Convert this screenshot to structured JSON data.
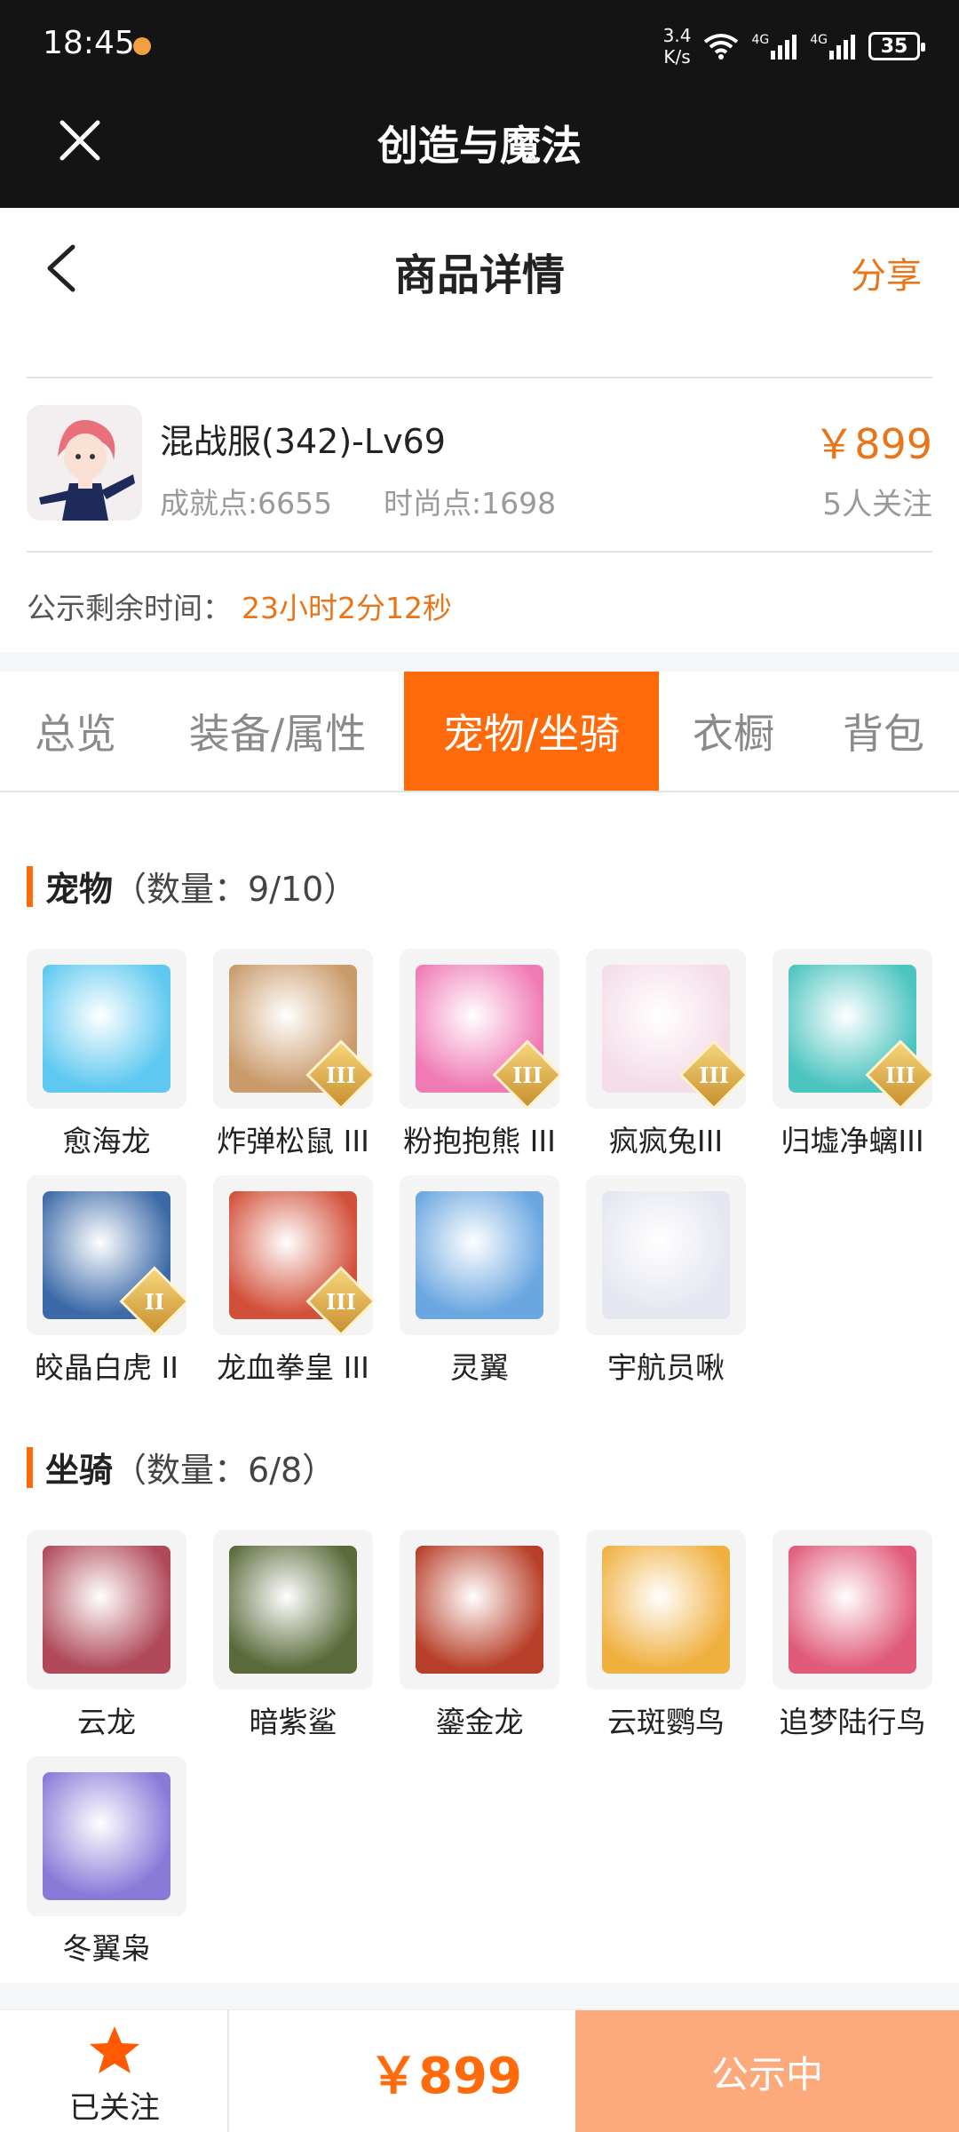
{
  "status_bar": {
    "time": "18:45",
    "net_speed": "3.4\nK/s",
    "net_speed_top": "3.4",
    "net_speed_bottom": "K/s",
    "signal_label": "4G",
    "battery": "35"
  },
  "app": {
    "title": "创造与魔法"
  },
  "header": {
    "title": "商品详情",
    "share_label": "分享"
  },
  "product": {
    "name": "混战服(342)-Lv69",
    "achievement": "成就点:6655",
    "fashion": "时尚点:1698",
    "price": "￥899",
    "watchers": "5人关注"
  },
  "countdown": {
    "label": "公示剩余时间：",
    "value": "23小时2分12秒"
  },
  "tabs": [
    {
      "label": "总览",
      "active": false
    },
    {
      "label": "装备/属性",
      "active": false
    },
    {
      "label": "宠物/坐骑",
      "active": true
    },
    {
      "label": "衣橱",
      "active": false
    },
    {
      "label": "背包",
      "active": false
    }
  ],
  "pets": {
    "title": "宠物",
    "count": "（数量：9/10）",
    "items": [
      {
        "name": "愈海龙",
        "icon": "sea-dragon-icon",
        "color": "#5ec8f0",
        "tier": ""
      },
      {
        "name": "炸弹松鼠 III",
        "icon": "bomb-squirrel-icon",
        "color": "#c99a6a",
        "tier": "III"
      },
      {
        "name": "粉抱抱熊 III",
        "icon": "pink-bear-icon",
        "color": "#f07ab4",
        "tier": "III"
      },
      {
        "name": "疯疯兔III",
        "icon": "crazy-rabbit-icon",
        "color": "#f4dce8",
        "tier": "III"
      },
      {
        "name": "归墟净螭III",
        "icon": "serpent-dragon-icon",
        "color": "#4cc4c0",
        "tier": "III"
      },
      {
        "name": "皎晶白虎 II",
        "icon": "crystal-tiger-icon",
        "color": "#3c6aa8",
        "tier": "II"
      },
      {
        "name": "龙血拳皇 III",
        "icon": "dragon-fist-icon",
        "color": "#d2503a",
        "tier": "III"
      },
      {
        "name": "灵翼",
        "icon": "spirit-wing-icon",
        "color": "#6aa6e0",
        "tier": ""
      },
      {
        "name": "宇航员啾",
        "icon": "astronaut-bird-icon",
        "color": "#e4e6f0",
        "tier": ""
      }
    ]
  },
  "mounts": {
    "title": "坐骑",
    "count": "（数量：6/8）",
    "items": [
      {
        "name": "云龙",
        "icon": "cloud-dragon-icon",
        "color": "#b04a5a",
        "tier": ""
      },
      {
        "name": "暗紫鲨",
        "icon": "purple-shark-icon",
        "color": "#5a6a3a",
        "tier": ""
      },
      {
        "name": "鎏金龙",
        "icon": "golden-dragon-icon",
        "color": "#b8402a",
        "tier": ""
      },
      {
        "name": "云斑鹦鸟",
        "icon": "parrot-icon",
        "color": "#f0b040",
        "tier": ""
      },
      {
        "name": "追梦陆行鸟",
        "icon": "dream-bird-icon",
        "color": "#e05a7a",
        "tier": ""
      },
      {
        "name": "冬翼枭",
        "icon": "winter-owl-icon",
        "color": "#8a7ad8",
        "tier": ""
      }
    ]
  },
  "bottom_bar": {
    "follow_label": "已关注",
    "price": "￥899",
    "status_label": "公示中"
  },
  "colors": {
    "accent": "#ff6a0a",
    "price": "#e8751a",
    "status_button": "#fcaa7c",
    "topbar": "#141414"
  }
}
